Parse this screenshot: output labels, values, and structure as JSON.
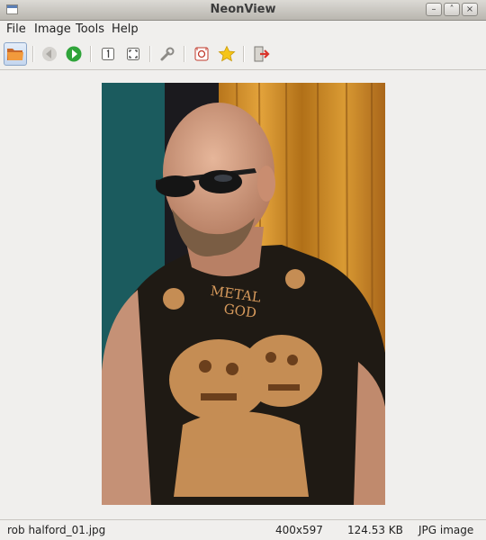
{
  "window": {
    "title": "NeonView",
    "controls": [
      "minimize-icon",
      "maximize-icon",
      "close-icon"
    ]
  },
  "menu": [
    "File",
    "Image",
    "Tools",
    "Help"
  ],
  "toolbar": {
    "buttons": [
      {
        "icon": "open-folder-icon",
        "state": "active"
      },
      {
        "icon": "previous-arrow-icon",
        "state": "disabled"
      },
      {
        "icon": "next-arrow-icon",
        "state": "enabled"
      },
      {
        "icon": "actual-size-icon",
        "state": "enabled"
      },
      {
        "icon": "fit-to-window-icon",
        "state": "enabled"
      },
      {
        "icon": "wrench-icon",
        "state": "enabled"
      },
      {
        "icon": "slideshow-icon",
        "state": "enabled"
      },
      {
        "icon": "favorite-star-icon",
        "state": "enabled"
      },
      {
        "icon": "exit-icon",
        "state": "enabled"
      }
    ]
  },
  "image": {
    "alt_icon": "photo-image"
  },
  "status": {
    "filename": "rob halford_01.jpg",
    "dimensions": "400x597",
    "filesize": "124.53 KB",
    "filetype": "JPG image"
  },
  "colors": {
    "accent": "#5b7fb6",
    "next_arrow": "#2fa43a",
    "star": "#f5c518",
    "exit": "#d9342b"
  }
}
